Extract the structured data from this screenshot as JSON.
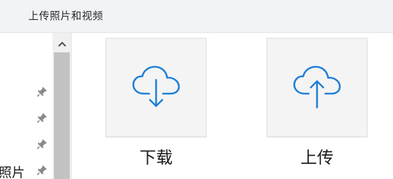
{
  "header": {
    "title": "上传照片和视频"
  },
  "sidebar": {
    "partial_label": "照片",
    "pin_icons": [
      "pin-icon",
      "pin-icon",
      "pin-icon",
      "pin-icon"
    ]
  },
  "scrollbar": {
    "up_icon": "chevron-up-icon"
  },
  "actions": {
    "download": {
      "label": "下载",
      "icon": "cloud-download-icon"
    },
    "upload": {
      "label": "上传",
      "icon": "cloud-upload-icon"
    }
  },
  "colors": {
    "accent": "#1e7fd6",
    "header_bg": "#f2f3f5",
    "tile_bg": "#f4f4f4"
  }
}
